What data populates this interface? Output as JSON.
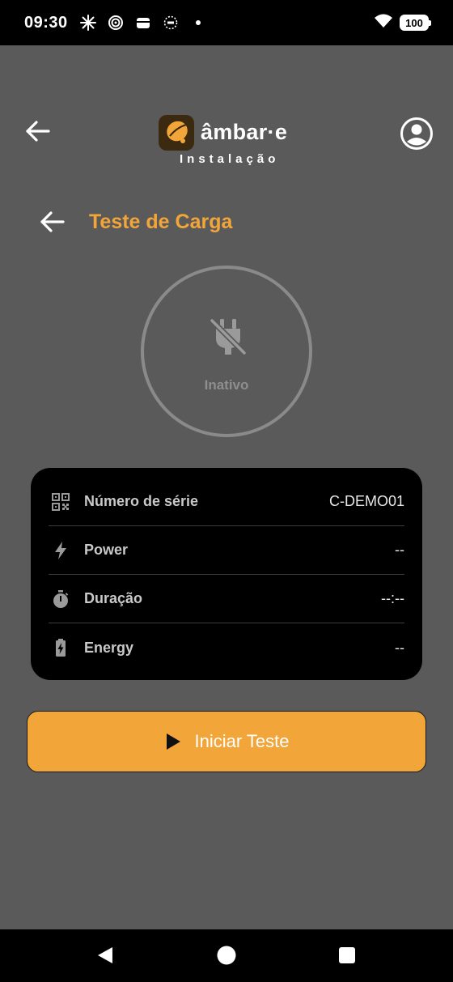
{
  "status_bar": {
    "time": "09:30",
    "battery": "100",
    "icons": [
      "sparkle-icon",
      "target-icon",
      "wallet-icon",
      "ring-icon",
      "dot-icon",
      "wifi-icon",
      "battery-icon"
    ]
  },
  "header": {
    "brand": "âmbar·e",
    "subtitle": "Instalação"
  },
  "page": {
    "title": "Teste de Carga"
  },
  "charger": {
    "status": "Inativo"
  },
  "info": {
    "rows": [
      {
        "icon": "qr-code-icon",
        "label": "Número de série",
        "value": "C-DEMO01"
      },
      {
        "icon": "bolt-icon",
        "label": "Power",
        "value": "--"
      },
      {
        "icon": "timer-icon",
        "label": "Duração",
        "value": "--:--"
      },
      {
        "icon": "battery-charging-icon",
        "label": "Energy",
        "value": "--"
      }
    ]
  },
  "actions": {
    "start_label": "Iniciar Teste"
  },
  "colors": {
    "accent": "#f2a63a",
    "background": "#5a5a5a",
    "card": "#000000"
  }
}
